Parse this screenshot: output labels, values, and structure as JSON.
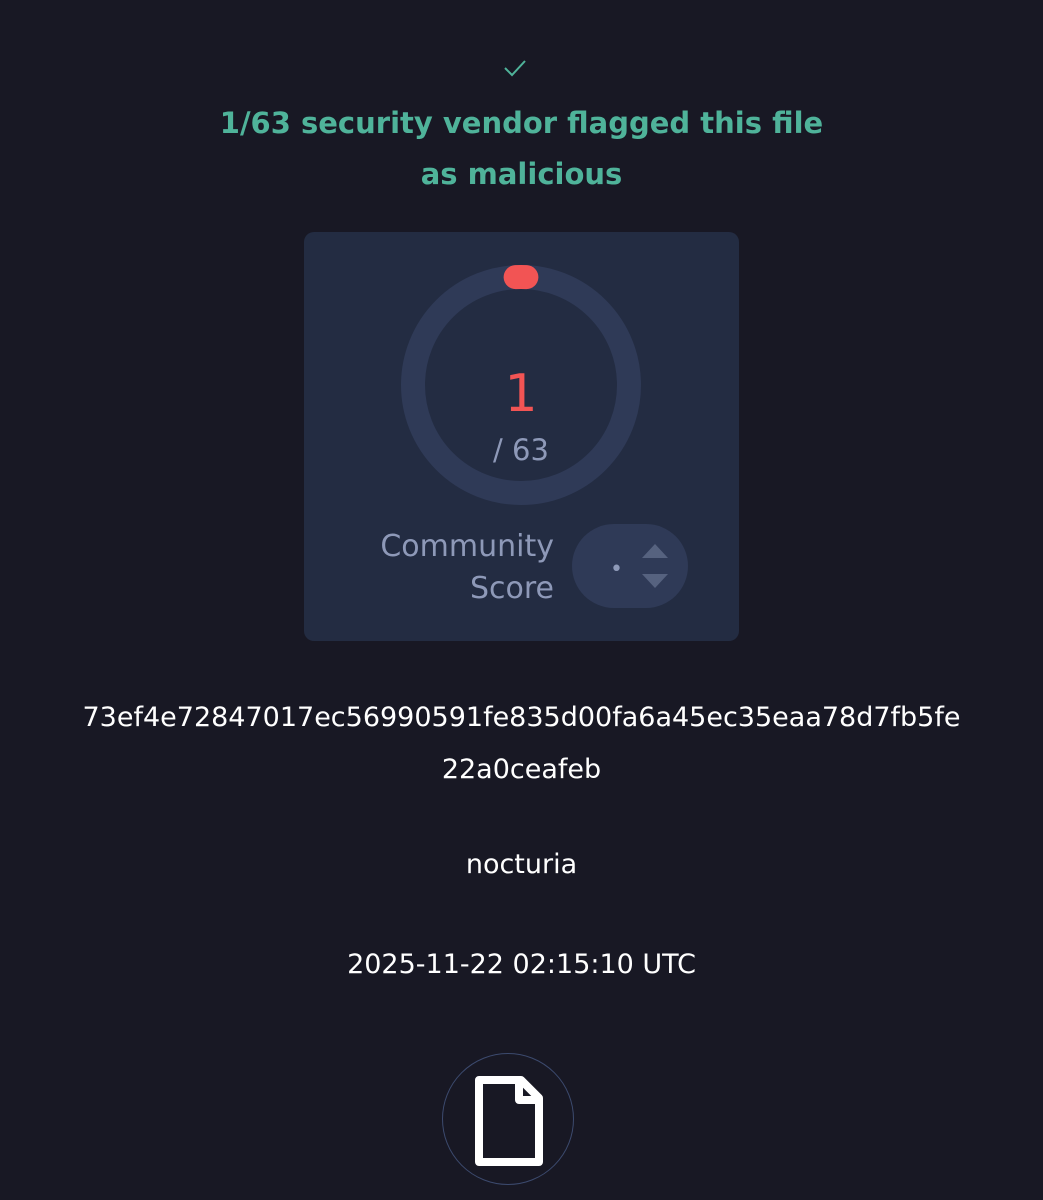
{
  "header": {
    "status_icon": "check-icon",
    "headline": "1/63 security vendor flagged this file as malicious",
    "accent_color": "#4fb39a"
  },
  "detection": {
    "count": "1",
    "total_label": "/ 63",
    "flagged": 1,
    "total": 63,
    "flag_color": "#f25454"
  },
  "community": {
    "label": "Community Score",
    "score_symbol": "•",
    "upvote_icon": "triangle-up-icon",
    "downvote_icon": "triangle-down-icon"
  },
  "file": {
    "hash": "73ef4e72847017ec56990591fe835d00fa6a45ec35eaa78d7fb5fe22a0ceafeb",
    "name": "nocturia",
    "date": "2025-11-22 02:15:10 UTC",
    "type_icon": "file-icon"
  }
}
